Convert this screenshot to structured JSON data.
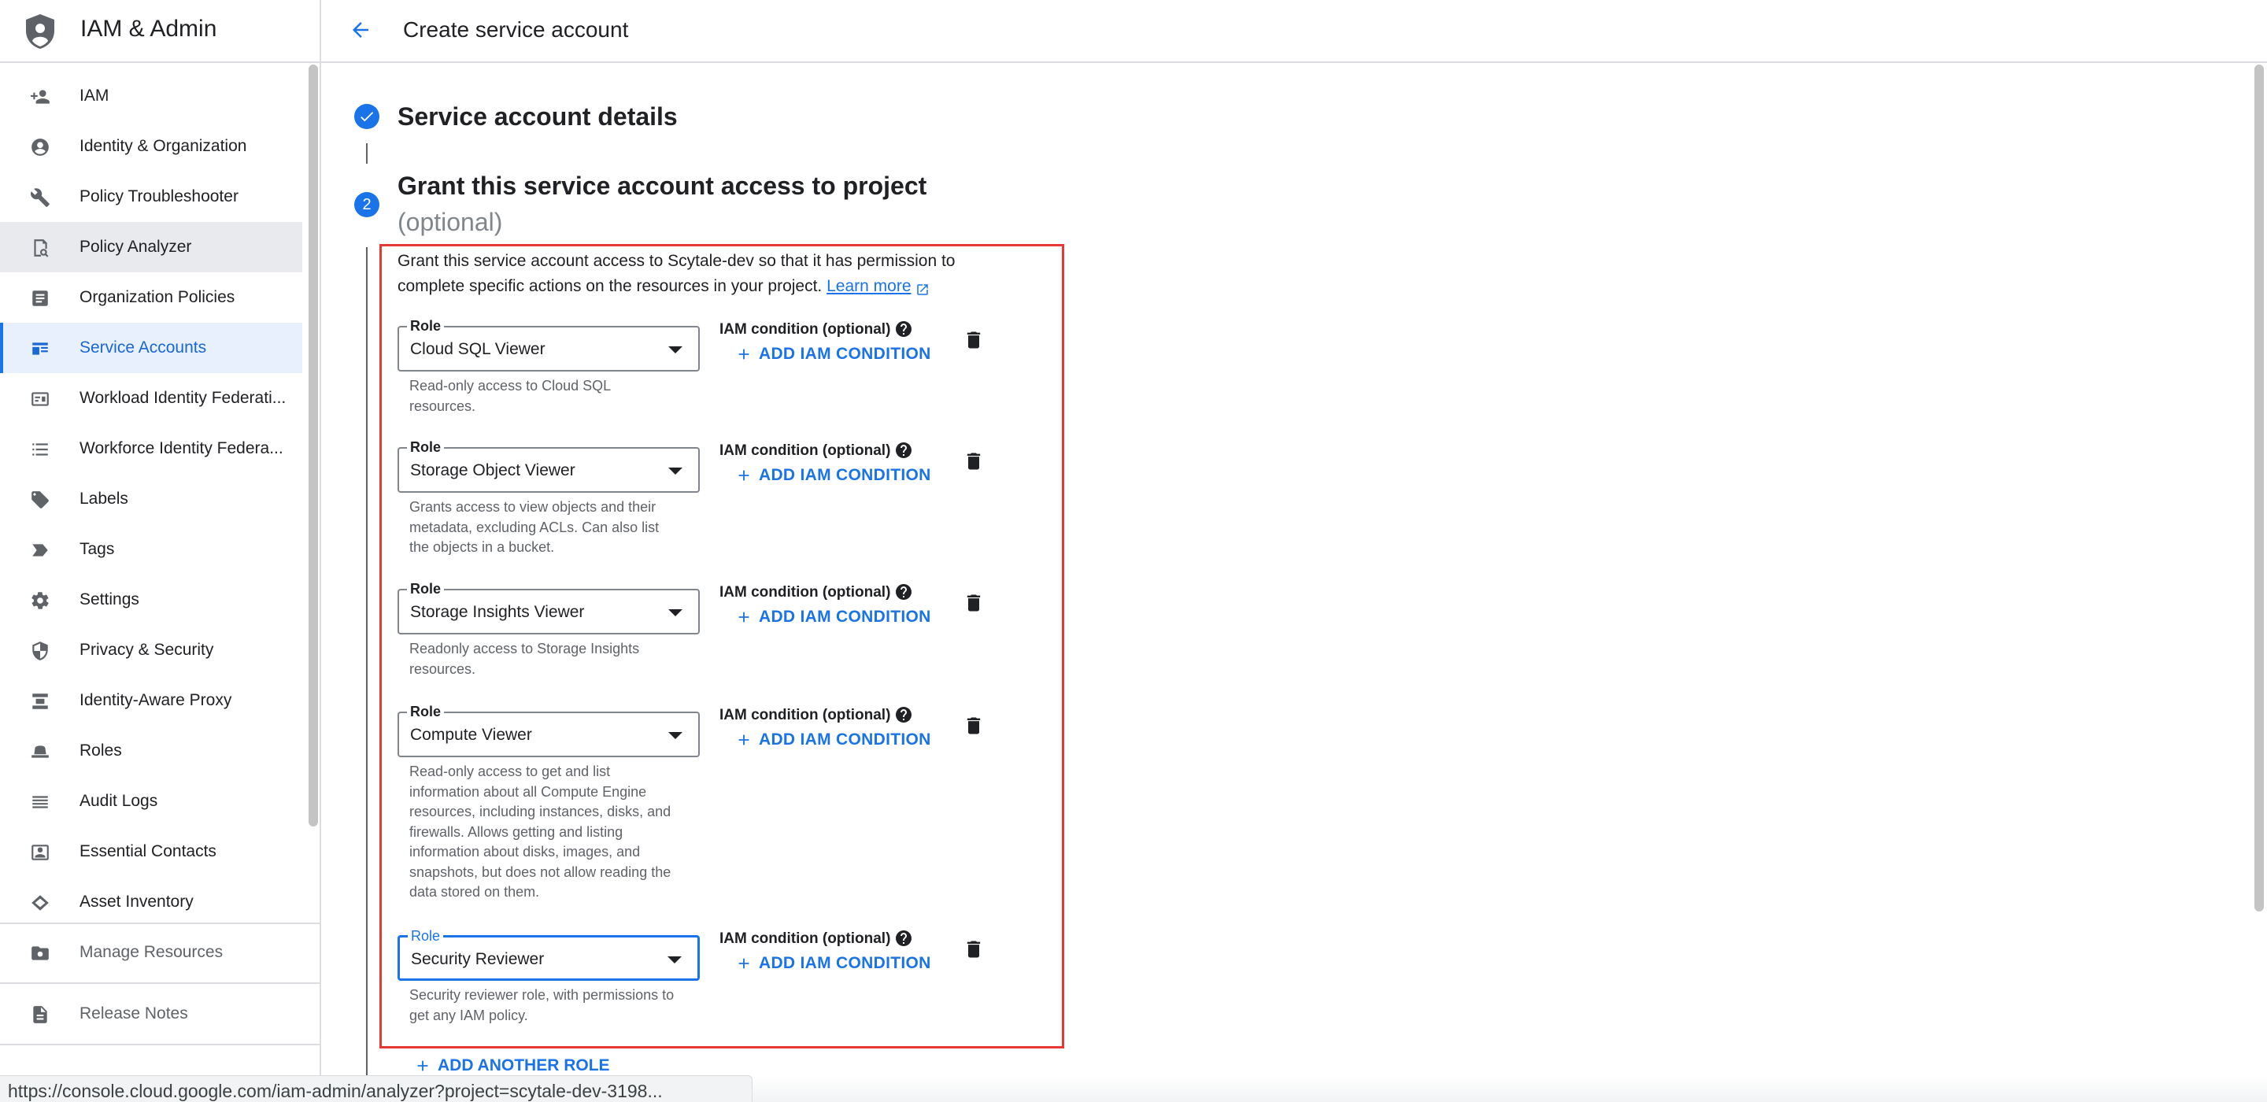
{
  "app": {
    "title": "IAM & Admin",
    "page_title": "Create service account"
  },
  "sidebar": {
    "items": [
      {
        "label": "IAM",
        "icon": "person-add-icon"
      },
      {
        "label": "Identity & Organization",
        "icon": "account-circle-icon"
      },
      {
        "label": "Policy Troubleshooter",
        "icon": "wrench-icon"
      },
      {
        "label": "Policy Analyzer",
        "icon": "policy-analyzer-icon"
      },
      {
        "label": "Organization Policies",
        "icon": "article-icon"
      },
      {
        "label": "Service Accounts",
        "icon": "service-account-icon"
      },
      {
        "label": "Workload Identity Federati...",
        "icon": "id-card-icon"
      },
      {
        "label": "Workforce Identity Federa...",
        "icon": "list-icon"
      },
      {
        "label": "Labels",
        "icon": "label-icon"
      },
      {
        "label": "Tags",
        "icon": "tag-icon"
      },
      {
        "label": "Settings",
        "icon": "gear-icon"
      },
      {
        "label": "Privacy & Security",
        "icon": "shield-icon"
      },
      {
        "label": "Identity-Aware Proxy",
        "icon": "proxy-icon"
      },
      {
        "label": "Roles",
        "icon": "hat-icon"
      },
      {
        "label": "Audit Logs",
        "icon": "lines-icon"
      },
      {
        "label": "Essential Contacts",
        "icon": "contact-icon"
      },
      {
        "label": "Asset Inventory",
        "icon": "layers-icon"
      }
    ],
    "manage_resources": "Manage Resources",
    "release_notes": "Release Notes"
  },
  "steps": {
    "step1_title": "Service account details",
    "step2_number": "2",
    "step2_title": "Grant this service account access to project",
    "step2_subtitle": "(optional)"
  },
  "grant": {
    "intro": "Grant this service account access to Scytale-dev so that it has permission to complete specific actions on the resources in your project.",
    "learn_more": "Learn more",
    "role_label": "Role",
    "condition_label": "IAM condition (optional)",
    "add_condition": "ADD IAM CONDITION",
    "add_another_role": "ADD ANOTHER ROLE",
    "roles": [
      {
        "value": "Cloud SQL Viewer",
        "description": "Read-only access to Cloud SQL resources."
      },
      {
        "value": "Storage Object Viewer",
        "description": "Grants access to view objects and their metadata, excluding ACLs. Can also list the objects in a bucket."
      },
      {
        "value": "Storage Insights Viewer",
        "description": "Readonly access to Storage Insights resources."
      },
      {
        "value": "Compute Viewer",
        "description": "Read-only access to get and list information about all Compute Engine resources, including instances, disks, and firewalls. Allows getting and listing information about disks, images, and snapshots, but does not allow reading the data stored on them."
      },
      {
        "value": "Security Reviewer",
        "description": "Security reviewer role, with permissions to get any IAM policy."
      }
    ]
  },
  "status_bar": {
    "url": "https://console.cloud.google.com/iam-admin/analyzer?project=scytale-dev-3198..."
  },
  "colors": {
    "accent": "#1a73e8",
    "highlight_border": "#e53935",
    "active_bg": "#e8f0fe",
    "hover_bg": "#e8eaed"
  }
}
